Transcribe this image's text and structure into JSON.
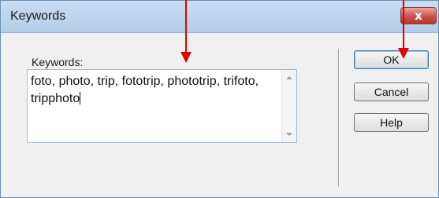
{
  "window": {
    "title": "Keywords",
    "close_glyph": "x"
  },
  "form": {
    "keywords_label": "Keywords:",
    "keywords_value": "foto, photo, trip, fototrip, phototrip, trifoto, tripphoto"
  },
  "buttons": {
    "ok": "OK",
    "cancel": "Cancel",
    "help": "Help"
  },
  "annotations": {
    "arrow_color": "#e00000",
    "arrow_count": 2
  }
}
